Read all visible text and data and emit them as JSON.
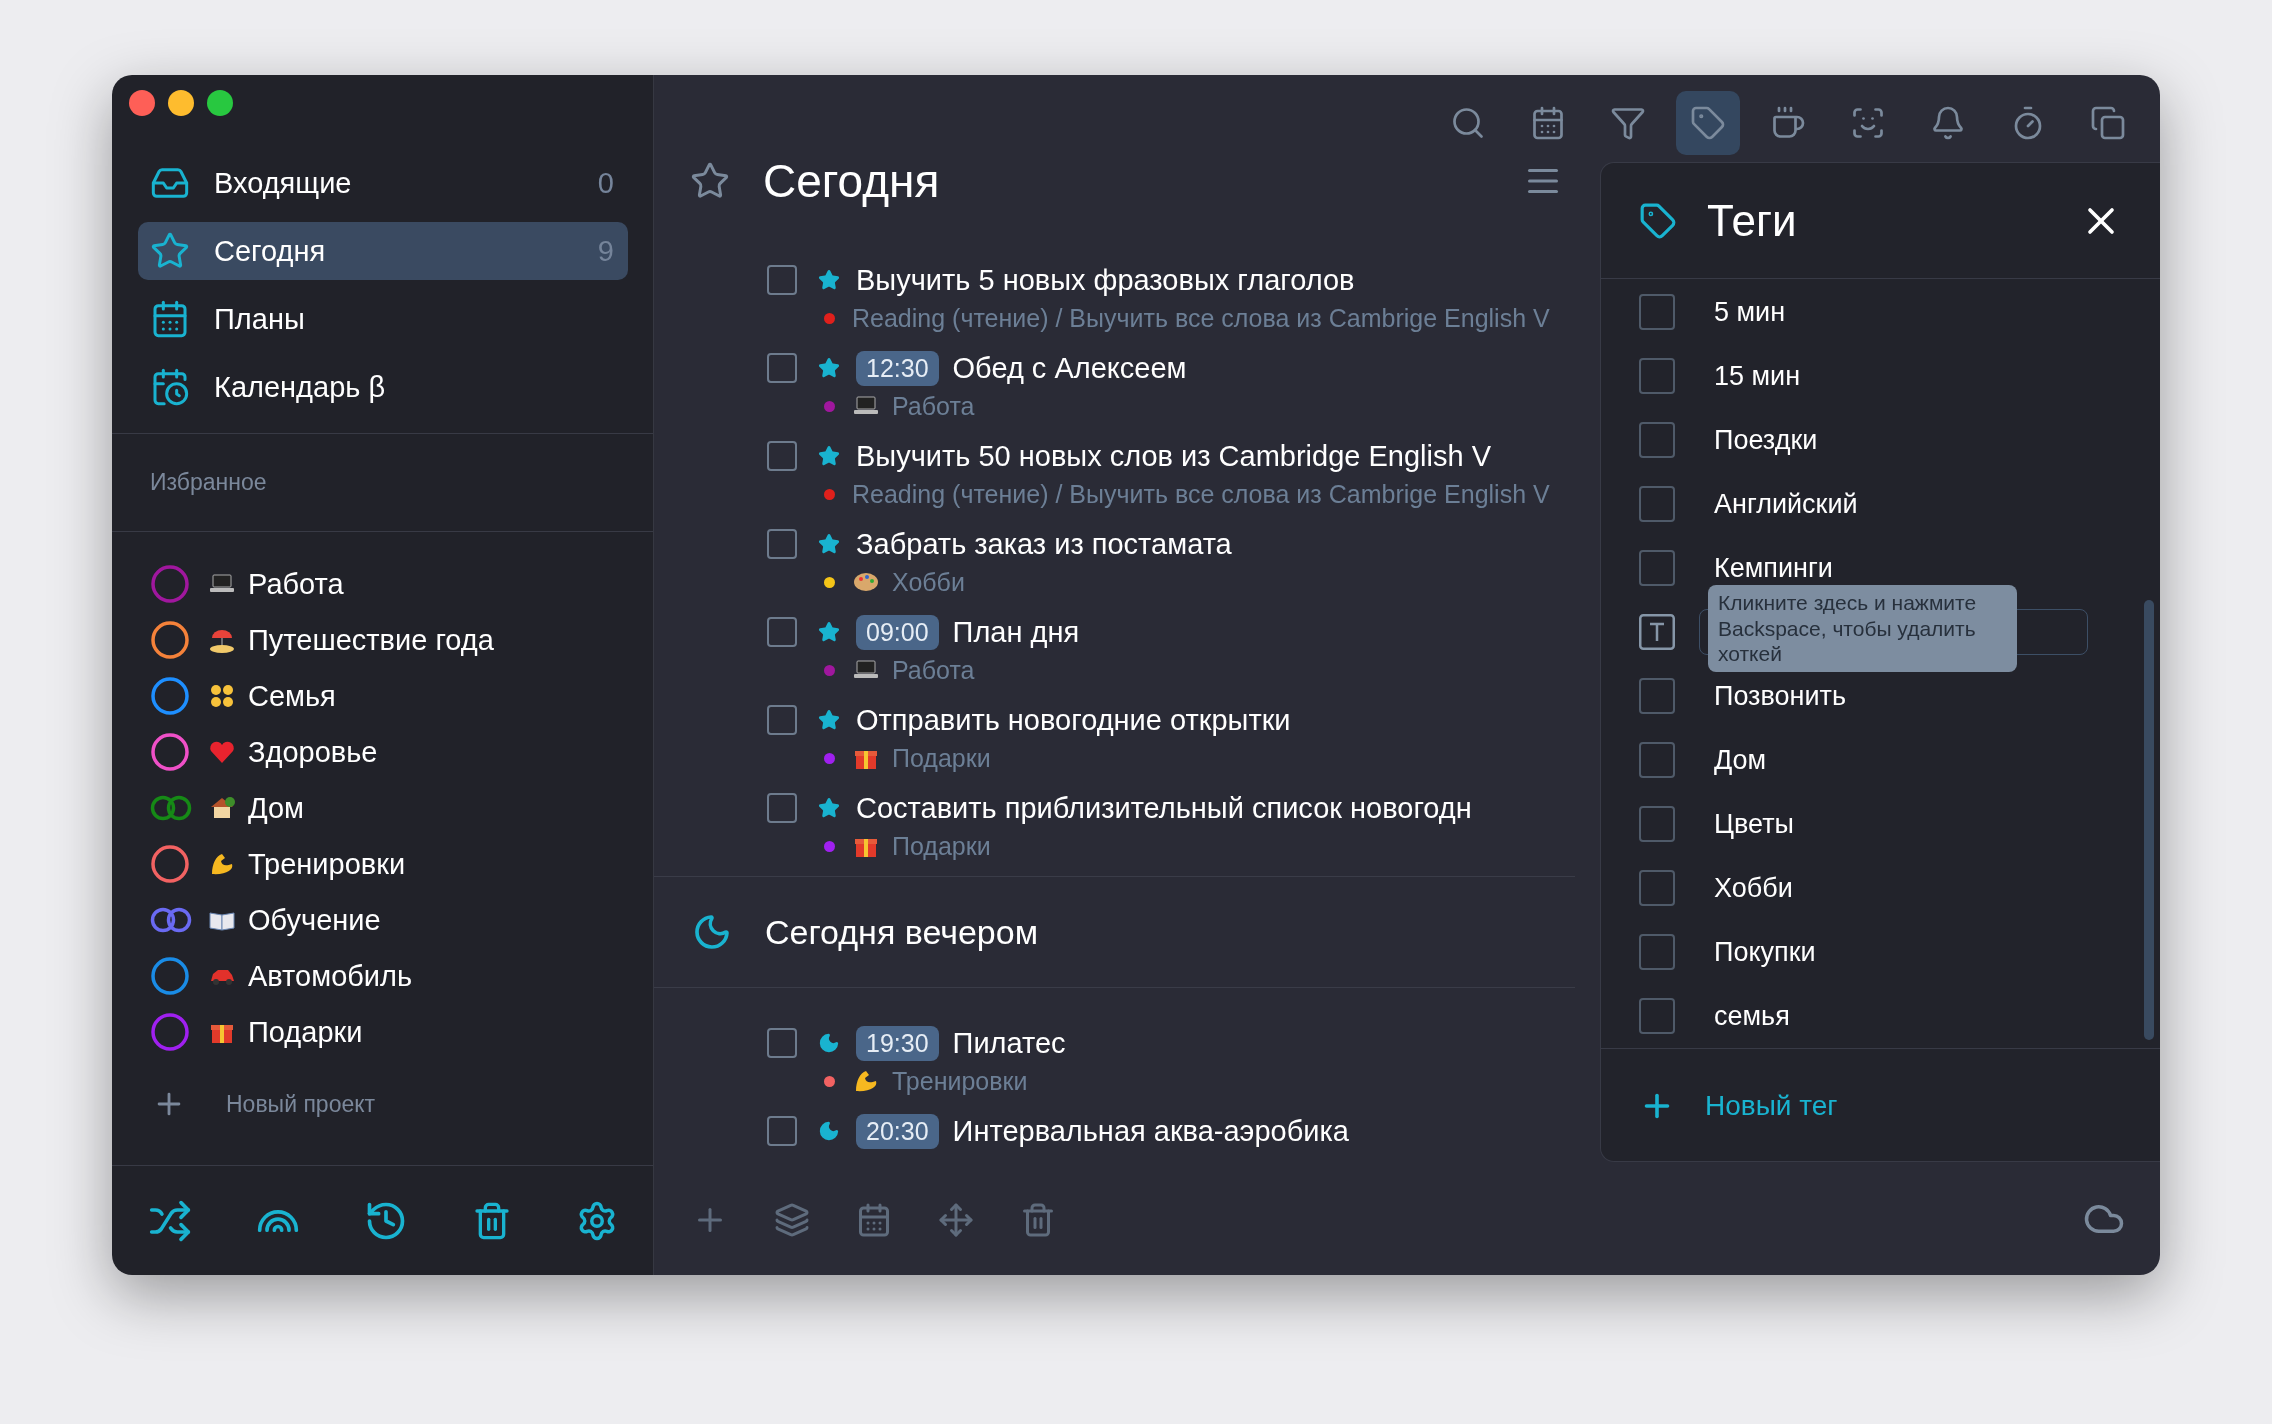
{
  "sidebar": {
    "nav": [
      {
        "label": "Входящие",
        "count": "0",
        "selected": false
      },
      {
        "label": "Сегодня",
        "count": "9",
        "selected": true
      },
      {
        "label": "Планы",
        "selected": false
      },
      {
        "label": "Календарь β",
        "selected": false
      }
    ],
    "favorites_heading": "Избранное",
    "projects": [
      {
        "label": "Работа",
        "kind": "laptop",
        "ring": {
          "kind": "single",
          "color": "#a0179e"
        }
      },
      {
        "label": "Путешествие года",
        "kind": "beach",
        "ring": {
          "kind": "single",
          "color": "#f5823a"
        }
      },
      {
        "label": "Семья",
        "kind": "family",
        "ring": {
          "kind": "single",
          "color": "#1e8fff"
        }
      },
      {
        "label": "Здоровье",
        "kind": "heart",
        "ring": {
          "kind": "single",
          "color": "#f050c8"
        }
      },
      {
        "label": "Дом",
        "kind": "house",
        "ring": {
          "kind": "double",
          "color": "#168a16"
        }
      },
      {
        "label": "Тренировки",
        "kind": "muscle",
        "ring": {
          "kind": "single",
          "color": "#f26262"
        }
      },
      {
        "label": "Обучение",
        "kind": "book",
        "ring": {
          "kind": "double",
          "color": "#6a6af2"
        }
      },
      {
        "label": "Автомобиль",
        "kind": "car",
        "ring": {
          "kind": "single",
          "color": "#1a8ce6"
        }
      },
      {
        "label": "Подарки",
        "kind": "gift",
        "ring": {
          "kind": "single",
          "color": "#a020f0"
        }
      }
    ],
    "new_project": "Новый проект"
  },
  "toolbar": [
    {
      "selected": false
    },
    {
      "selected": false
    },
    {
      "selected": false
    },
    {
      "selected": true
    },
    {
      "selected": false
    },
    {
      "selected": false
    },
    {
      "selected": false
    },
    {
      "selected": false
    },
    {
      "selected": false
    }
  ],
  "list": {
    "title": "Сегодня",
    "tasks": [
      {
        "kind": "star",
        "checked": false,
        "title": "Выучить 5 новых фразовых глаголов",
        "project": {
          "kind": "none",
          "label": "Reading (чтение) / Выучить все слова из Cambrige English V",
          "color": "#e0201c"
        }
      },
      {
        "kind": "star",
        "checked": false,
        "time": "12:30",
        "title": "Обед с Алексеем",
        "project": {
          "kind": "laptop",
          "label": "Работа",
          "color": "#a0179e"
        }
      },
      {
        "kind": "star",
        "checked": false,
        "title": "Выучить 50 новых слов из Cambridge English V",
        "project": {
          "kind": "none",
          "label": "Reading (чтение) / Выучить все слова из Cambrige English V",
          "color": "#e0201c"
        }
      },
      {
        "kind": "star",
        "checked": false,
        "title": "Забрать заказ из постамата",
        "project": {
          "kind": "palette",
          "label": "Хобби",
          "color": "#f5c518"
        }
      },
      {
        "kind": "star",
        "checked": false,
        "time": "09:00",
        "title": "План дня",
        "project": {
          "kind": "laptop",
          "label": "Работа",
          "color": "#a0179e"
        }
      },
      {
        "kind": "star",
        "checked": false,
        "title": "Отправить новогодние открытки",
        "project": {
          "kind": "gift",
          "label": "Подарки",
          "color": "#a020f0"
        }
      },
      {
        "kind": "star",
        "checked": false,
        "title": "Составить приблизительный список новогодн",
        "project": {
          "kind": "gift",
          "label": "Подарки",
          "color": "#a020f0"
        }
      }
    ],
    "evening": {
      "title": "Сегодня вечером",
      "tasks": [
        {
          "kind": "moon",
          "checked": false,
          "time": "19:30",
          "title": "Пилатес",
          "project": {
            "kind": "muscle",
            "label": "Тренировки",
            "color": "#f26262"
          }
        },
        {
          "kind": "moon",
          "checked": false,
          "time": "20:30",
          "title": "Интервальная аква-аэробика"
        }
      ]
    }
  },
  "tags_panel": {
    "title": "Теги",
    "tags": [
      {
        "kind": "checkbox",
        "label": "5 мин",
        "checked": false
      },
      {
        "kind": "checkbox",
        "label": "15 мин",
        "checked": false
      },
      {
        "kind": "checkbox",
        "label": "Поездки",
        "checked": false
      },
      {
        "kind": "checkbox",
        "label": "Английский",
        "checked": false
      },
      {
        "kind": "checkbox",
        "label": "Кемпинги",
        "checked": false
      },
      {
        "kind": "hotkey",
        "tooltip": "Кликните здесь и нажмите Backspace, чтобы удалить хоткей"
      },
      {
        "kind": "checkbox",
        "label": "Позвонить",
        "checked": false
      },
      {
        "kind": "checkbox",
        "label": "Дом",
        "checked": false
      },
      {
        "kind": "checkbox",
        "label": "Цветы",
        "checked": false
      },
      {
        "kind": "checkbox",
        "label": "Хобби",
        "checked": false
      },
      {
        "kind": "checkbox",
        "label": "Покупки",
        "checked": false
      },
      {
        "kind": "checkbox",
        "label": "семья",
        "checked": false
      }
    ],
    "new_tag": "Новый тег"
  }
}
